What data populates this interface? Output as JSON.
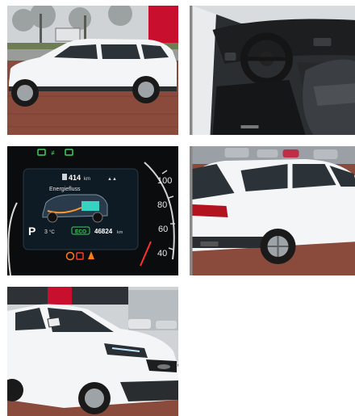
{
  "gallery": {
    "photos": [
      {
        "name": "exterior-side"
      },
      {
        "name": "interior-cockpit"
      },
      {
        "name": "instrument-cluster"
      },
      {
        "name": "exterior-rear"
      },
      {
        "name": "exterior-front"
      }
    ]
  },
  "dashboard": {
    "range": "414",
    "range_unit": "km",
    "screen_title": "Energiefluss",
    "gear": "P",
    "temperature": "3",
    "temperature_unit": "°C",
    "mode_badge": "ECO",
    "odometer": "46824",
    "odometer_unit": "km",
    "speed_ticks": [
      "100",
      "80",
      "60",
      "40"
    ]
  },
  "colors": {
    "car_white": "#f4f5f6",
    "brick": "#8a4a3c",
    "sky": "#cfd3d6",
    "dash_screen": "#0e1a24",
    "accent_green": "#3ad35a",
    "accent_orange": "#ff7a1a",
    "kia_red": "#c8102e"
  }
}
